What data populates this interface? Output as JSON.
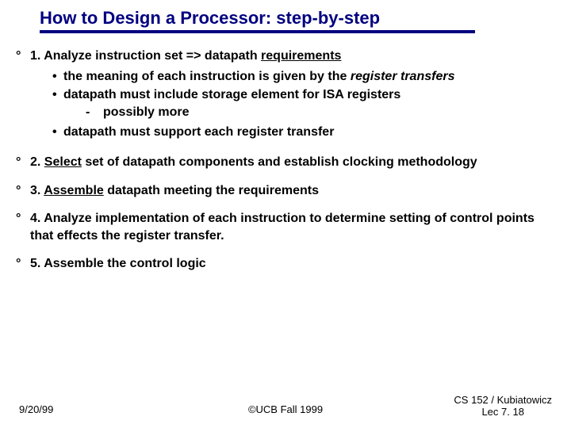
{
  "title": "How to Design a Processor: step-by-step",
  "steps": {
    "s1": {
      "head_a": "1. Analyze instruction set => datapath ",
      "head_u": "requirements",
      "b1_a": "the meaning of each instruction is given by the ",
      "b1_i": "register transfers",
      "b2": "datapath must include storage element for ISA registers",
      "b2_sub": "possibly more",
      "b3": "datapath must support each register transfer"
    },
    "s2": {
      "a": "2. ",
      "u": "Select",
      "b": " set of datapath components and establish clocking methodology"
    },
    "s3": {
      "a": "3. ",
      "u": "Assemble",
      "b": " datapath meeting the requirements"
    },
    "s4": "4. Analyze implementation of each instruction to determine setting of control points that effects the register transfer.",
    "s5": "5. Assemble the control logic"
  },
  "footer": {
    "left": "9/20/99",
    "center": "©UCB Fall 1999",
    "right1": "CS 152 / Kubiatowicz",
    "right2": "Lec 7. 18"
  }
}
